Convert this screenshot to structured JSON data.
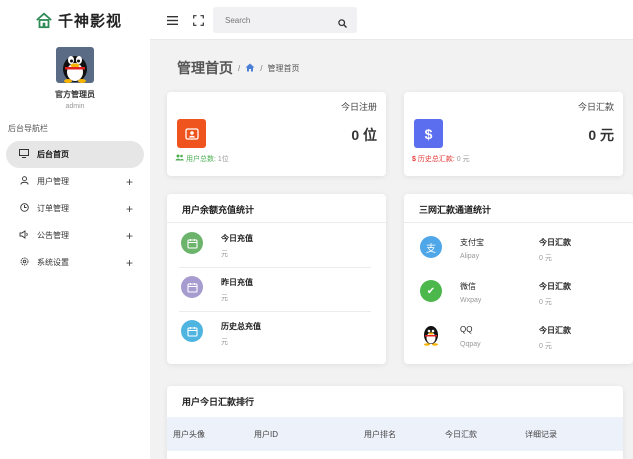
{
  "brand": {
    "name": "千神影视"
  },
  "profile": {
    "name": "官方管理员",
    "role": "admin"
  },
  "sidebar": {
    "heading": "后台导航栏",
    "items": [
      {
        "label": "后台首页",
        "icon": "monitor-icon",
        "active": true,
        "expandable": false
      },
      {
        "label": "用户管理",
        "icon": "user-icon",
        "active": false,
        "expandable": true
      },
      {
        "label": "订单管理",
        "icon": "clock-icon",
        "active": false,
        "expandable": true
      },
      {
        "label": "公告管理",
        "icon": "speaker-icon",
        "active": false,
        "expandable": true
      },
      {
        "label": "系统设置",
        "icon": "gear-icon",
        "active": false,
        "expandable": true
      }
    ],
    "expand_symbol": "+"
  },
  "topbar": {
    "search_placeholder": "Search"
  },
  "page": {
    "title": "管理首页",
    "breadcrumb": [
      "管理首页"
    ]
  },
  "stats": {
    "register": {
      "label": "今日注册",
      "value": "0 位",
      "footer_label": "用户总数:",
      "footer_value": "1位",
      "icon_color": "#f0541e",
      "accent": "#4caf50"
    },
    "remit": {
      "label": "今日汇款",
      "value": "0 元",
      "icon_symbol": "$",
      "footer_label": "历史总汇款:",
      "footer_value": "0 元",
      "icon_color": "#5b6ef0",
      "accent": "#e53935"
    }
  },
  "recharge": {
    "title": "用户余额充值统计",
    "rows": [
      {
        "name": "今日充值",
        "unit": "元",
        "color": "#6cb36c"
      },
      {
        "name": "昨日充值",
        "unit": "元",
        "color": "#a79ccf"
      },
      {
        "name": "历史总充值",
        "unit": "元",
        "color": "#4fb4e0"
      }
    ]
  },
  "channels": {
    "title": "三网汇款通道统计",
    "today_label": "今日汇款",
    "rows": [
      {
        "name": "支付宝",
        "sub": "Alipay",
        "value": "0 元",
        "icon_symbol": "支",
        "color": "#4fa6e8"
      },
      {
        "name": "微信",
        "sub": "Wxpay",
        "value": "0 元",
        "icon_symbol": "✔",
        "color": "#4cb84c"
      },
      {
        "name": "QQ",
        "sub": "Qqpay",
        "value": "0 元",
        "color": "#222222"
      }
    ]
  },
  "ranking": {
    "title": "用户今日汇款排行",
    "columns": [
      "用户头像",
      "用户ID",
      "用户排名",
      "今日汇款",
      "详细记录"
    ]
  }
}
